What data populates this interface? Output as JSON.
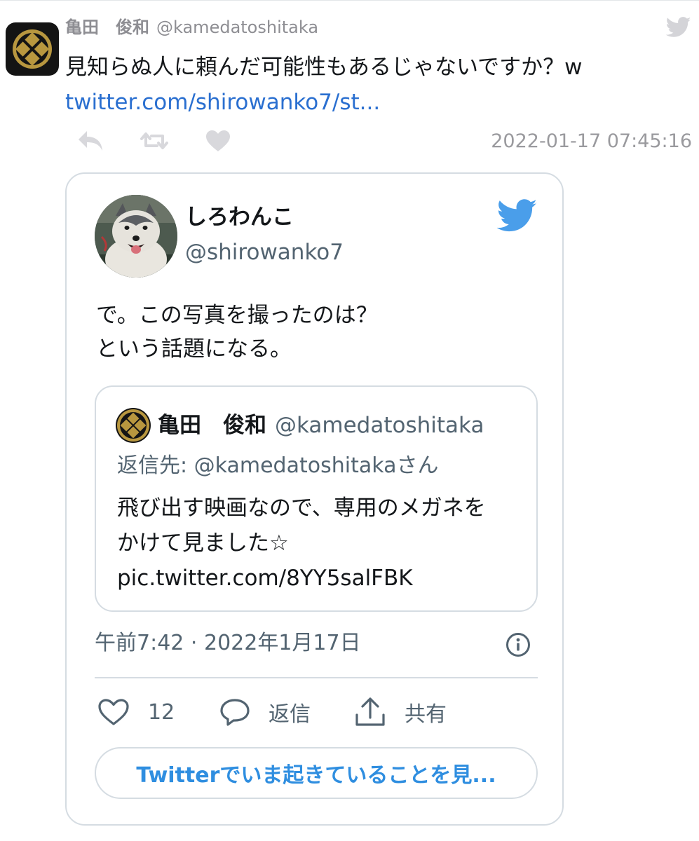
{
  "tweet": {
    "name": "亀田　俊和",
    "handle": "@kamedatoshitaka",
    "text": "見知らぬ人に頼んだ可能性もあるじゃないですか？w",
    "link": "twitter.com/shirowanko7/st...",
    "timestamp": "2022-01-17 07:45:16",
    "avatar_icon": "family-crest-icon",
    "actions": [
      "reply-icon",
      "retweet-icon",
      "like-icon"
    ]
  },
  "embed": {
    "name": "しろわんこ",
    "handle": "@shirowanko7",
    "text_lines": [
      "で。この写真を撮ったのは？",
      "という話題になる。"
    ],
    "quoted": {
      "name": "亀田　俊和",
      "handle": "@kamedatoshitaka",
      "reply_to": "返信先: @kamedatoshitakaさん",
      "text_lines": [
        "飛び出す映画なので、専用のメガネを",
        "かけて見ました☆",
        "pic.twitter.com/8YY5salFBK"
      ]
    },
    "date": "午前7:42 · 2022年1月17日",
    "stats": {
      "like_count": "12",
      "reply_label": "返信",
      "share_label": "共有"
    },
    "cta": "Twitterでいま起きていることを見..."
  },
  "colors": {
    "link": "#2a6fd0",
    "twitter_blue": "#4a9eea",
    "muted": "#536471",
    "border": "#d5dce2"
  }
}
